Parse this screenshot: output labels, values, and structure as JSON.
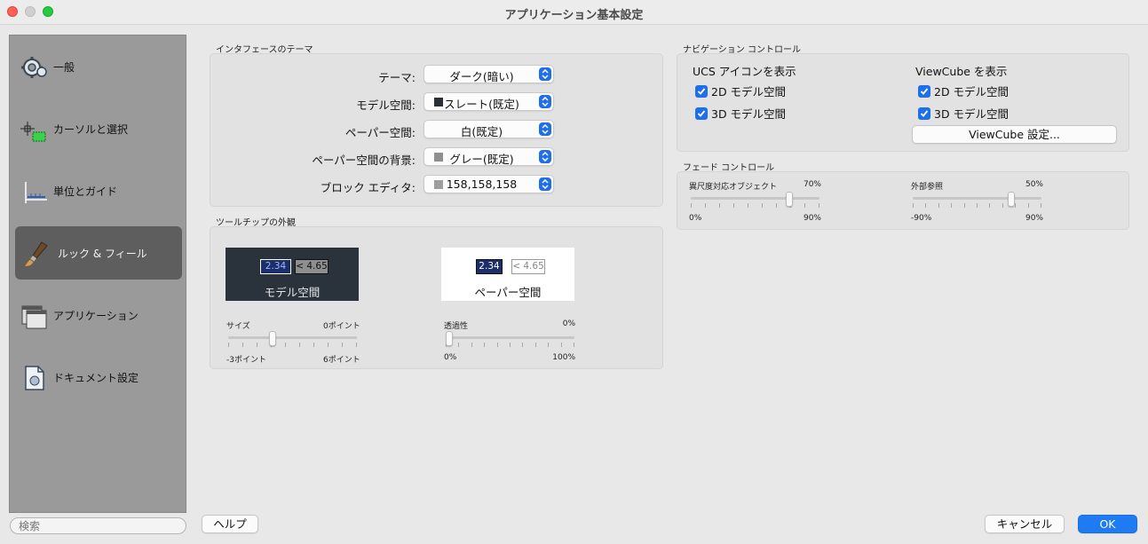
{
  "window": {
    "title": "アプリケーション基本設定"
  },
  "sidebar": {
    "items": [
      {
        "label": "一般",
        "icon": "gear-icon"
      },
      {
        "label": "カーソルと選択",
        "icon": "cursor-select-icon"
      },
      {
        "label": "単位とガイド",
        "icon": "ruler-icon"
      },
      {
        "label": "ルック & フィール",
        "icon": "brush-icon",
        "active": true
      },
      {
        "label": "アプリケーション",
        "icon": "windows-icon"
      },
      {
        "label": "ドキュメント設定",
        "icon": "document-icon"
      }
    ],
    "search_placeholder": "検索"
  },
  "interface_theme": {
    "title": "インタフェースのテーマ",
    "rows": [
      {
        "label": "テーマ:",
        "value": "ダーク(暗い)"
      },
      {
        "label": "モデル空間:",
        "value": "スレート(既定)",
        "swatch": "#2b2f36"
      },
      {
        "label": "ペーパー空間:",
        "value": "白(既定)"
      },
      {
        "label": "ペーパー空間の背景:",
        "value": "グレー(既定)",
        "swatch": "#8f8f8f"
      },
      {
        "label": "ブロック エディタ:",
        "value": "158,158,158",
        "swatch": "#9e9e9e"
      }
    ]
  },
  "tooltip_appearance": {
    "title": "ツールチップの外観",
    "model_preview": {
      "value1": "2.34",
      "value2": "< 4.65",
      "label": "モデル空間",
      "bg": "#2a323c"
    },
    "paper_preview": {
      "value1": "2.34",
      "value2": "< 4.65",
      "label": "ペーパー空間",
      "bg": "#ffffff"
    },
    "size_slider": {
      "label": "サイズ",
      "current": "0ポイント",
      "min": "-3ポイント",
      "max": "6ポイント",
      "level": 0.333
    },
    "transparency_slider": {
      "label": "透過性",
      "current": "0%",
      "min": "0%",
      "max": "100%",
      "level": 0.0
    }
  },
  "navigation_controls": {
    "title": "ナビゲーション コントロール",
    "ucs": {
      "heading": "UCS アイコンを表示",
      "options": [
        "2D モデル空間",
        "3D モデル空間"
      ]
    },
    "viewcube": {
      "heading": "ViewCube を表示",
      "options": [
        "2D モデル空間",
        "3D モデル空間"
      ],
      "button": "ViewCube 設定..."
    }
  },
  "fade_control": {
    "title": "フェード コントロール",
    "xref_object": {
      "label": "異尺度対応オブジェクト",
      "current": "70%",
      "min": "0%",
      "max": "90%",
      "level": 0.778
    },
    "xref": {
      "label": "外部参照",
      "current": "50%",
      "min": "-90%",
      "max": "90%",
      "level": 0.778
    }
  },
  "buttons": {
    "help": "ヘルプ",
    "cancel": "キャンセル",
    "ok": "OK"
  },
  "colors": {
    "accent": "#1f6feb",
    "sidebar_active": "#5e5e5e"
  }
}
